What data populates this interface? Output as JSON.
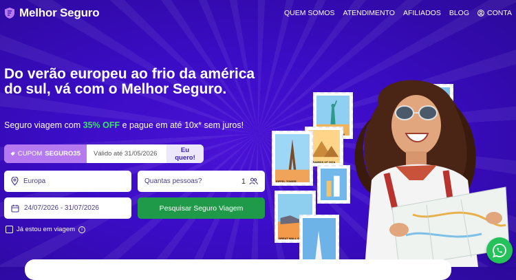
{
  "brand": {
    "name": "Melhor Seguro",
    "accent": "#3a0cc4"
  },
  "nav": {
    "items": [
      "QUEM SOMOS",
      "ATENDIMENTO",
      "AFILIADOS",
      "BLOG"
    ],
    "account": "CONTA"
  },
  "hero": {
    "headline": "Do verão europeu ao frio da américa do sul, vá com o Melhor Seguro.",
    "sub_before": "Seguro viagem com ",
    "sub_highlight": "35% OFF",
    "sub_after": " e pague em até 10x* sem juros!"
  },
  "coupon": {
    "prefix": "CUPOM",
    "code": "SEGURO35",
    "valid": "Válido até 31/05/2026",
    "cta": "Eu quero!"
  },
  "form": {
    "destination": "Europa",
    "people_label": "Quantas pessoas?",
    "people_count": "1",
    "dates": "24/07/2026 - 31/07/2026",
    "submit": "Pesquisar Seguro Viagem",
    "already_traveling": "Já estou em viagem"
  },
  "stamps": [
    "STATUE OF LIBERTY",
    "PYRAMIDS OF GIZA",
    "EIFFEL TOWER",
    "GREAT WALL OF CHINA"
  ],
  "colors": {
    "cta_green": "#1e9a48",
    "coupon_purple": "#b67af0",
    "highlight": "#3ee06a",
    "whatsapp": "#25c15b"
  }
}
